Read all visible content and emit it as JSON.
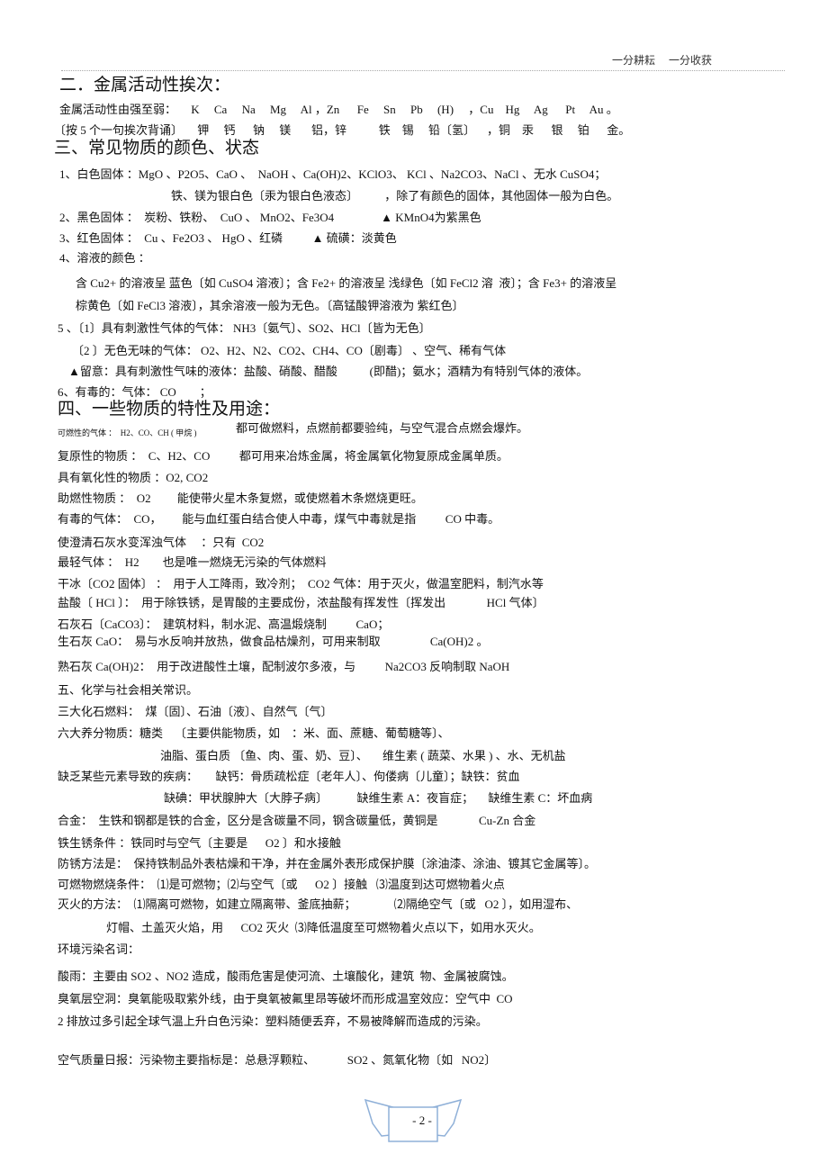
{
  "header": {
    "motto": "一分耕耘     一分收获"
  },
  "lines": [
    "二．金属活动性挨次：",
    "金属活动性由强至弱：     K     Ca     Na     Mg     Al ，Zn      Fe     Sn     Pb     (H)     ，Cu    Hg     Ag      Pt     Au 。",
    "〔按 5 个一句挨次背诵〕     钾     钙      钠     镁       铝，锌           铁    锡     铅〔氢〕    ，铜    汞      银     铂      金。",
    "三、常见物质的颜色、状态",
    "1、白色固体 ：MgO 、P2O5、CaO 、  NaOH 、Ca(OH)2、KClO3、 KCl 、Na2CO3、NaCl 、无水 CuSO4；",
    "铁、镁为银白色〔汞为银白色液态〕         ，除了有颜色的固体，其他固体一般为白色。",
    "2、黑色固体 ：  炭粉、铁粉、  CuO 、 MnO2、Fe3O4                ▲ KMnO4为紫黑色",
    "3、红色固体 ：  Cu 、Fe2O3 、 HgO 、红磷          ▲ 硫磺：淡黄色",
    "4、溶液的颜色 ：",
    "含 Cu2+ 的溶液呈 蓝色〔如 CuSO4 溶液〕；含 Fe2+ 的溶液呈 浅绿色〔如 FeCl2 溶  液〕；含 Fe3+ 的溶液呈",
    "棕黄色〔如 FeCl3 溶液〕，其余溶液一般为无色。〔高锰酸钾溶液为 紫红色〕",
    "5 、〔1〕具有刺激性气体的气体： NH3〔氨气〕、SO2、HCl〔皆为无色〕",
    "〔2 〕无色无味的气体： O2、H2、N2、CO2、CH4、CO〔剧毒〕 、空气、稀有气体",
    "▲留意：具有刺激性气味的液体：盐酸、硝酸、醋酸           (即醋)；氨水；酒精为有特别气体的液体。",
    "6、有毒的：气体： CO        ；",
    "四、一些物质的特性及用途：",
    "可燃性的气体 ：  H2、CO、CH ( 甲烷 )",
    "都可做燃料，点燃前都要验纯，与空气混合点燃会爆炸。",
    "复原性的物质 ：  C、H2、CO          都可用来冶炼金属，将金属氧化物复原成金属单质。",
    "具有氧化性的物质 ：O2, CO2",
    "助燃性物质 ：  O2         能使带火星木条复燃，或使燃着木条燃烧更旺。",
    "有毒的气体：  CO，       能与血红蛋白结合使人中毒，煤气中毒就是指          CO 中毒。",
    "使澄清石灰水变浑浊气体     ：只有  CO2",
    "最轻气体 ：  H2        也是唯一燃烧无污染的气体燃料",
    "干冰〔CO2 固体〕 ：  用于人工降雨，致冷剂；  CO2 气体：用于灭火，做温室肥料，制汽水等",
    "盐酸〔 HCl 〕：  用于除铁锈，是胃酸的主要成份，浓盐酸有挥发性〔挥发出              HCl 气体〕",
    "石灰石〔CaCO3〕：  建筑材料，制水泥、高温煅烧制          CaO；",
    "生石灰 CaO：  易与水反响并放热，做食品枯燥剂，可用来制取                 Ca(OH)2 。",
    "熟石灰 Ca(OH)2：  用于改进酸性土壤，配制波尔多液，与          Na2CO3 反响制取 NaOH",
    "五、化学与社会相关常识。",
    "三大化石燃料：  煤〔固〕、石油〔液〕、自然气〔气〕",
    "六大养分物质：糖类    〔主要供能物质，如    ：米、面、蔗糖、葡萄糖等〕、",
    "油脂、蛋白质 〔鱼、肉、蛋、奶、豆〕、     维生素 ( 蔬菜、水果 ) 、水、无机盐",
    "缺乏某些元素导致的疾病：      缺钙：骨质疏松症〔老年人〕、佝偻病〔儿童〕；缺铁：贫血",
    "缺碘：甲状腺肿大〔大脖子病〕          缺维生素 A：夜盲症；     缺维生素 C：坏血病",
    "合金：  生铁和钢都是铁的合金，区分是含碳量不同，钢含碳量低，黄铜是              Cu-Zn 合金",
    "铁生锈条件 ：铁同时与空气〔主要是      O2 〕和水接触",
    "防锈方法是：  保持铁制品外表枯燥和干净，并在金属外表形成保护膜〔涂油漆、涂油、镀其它金属等〕。",
    "可燃物燃烧条件：  ⑴是可燃物；⑵与空气〔或      O2 〕接触   ⑶温度到达可燃物着火点",
    "灭火的方法：  ⑴隔离可燃物，如建立隔离带、釜底抽薪；             ⑵隔绝空气〔或   O2 〕，如用湿布、",
    "灯帽、土盖灭火焰，用      CO2 灭火  ⑶降低温度至可燃物着火点以下，如用水灭火。",
    "环境污染名词：",
    "酸雨：主要由 SO2 、NO2 造成，酸雨危害是使河流、土壤酸化，建筑  物、金属被腐蚀。",
    "臭氧层空洞：臭氧能吸取紫外线，由于臭氧被氟里昂等破坏而形成温室效应：空气中  CO",
    "2 排放过多引起全球气温上升白色污染：塑料随便丢弃，不易被降解而造成的污染。",
    "空气质量日报：污染物主要指标是：总悬浮颗粒、           SO2 、氮氧化物〔如   NO2〕"
  ],
  "footer": {
    "page_number": "- 2 -",
    "ribbon_color": "#8fb0d8"
  }
}
